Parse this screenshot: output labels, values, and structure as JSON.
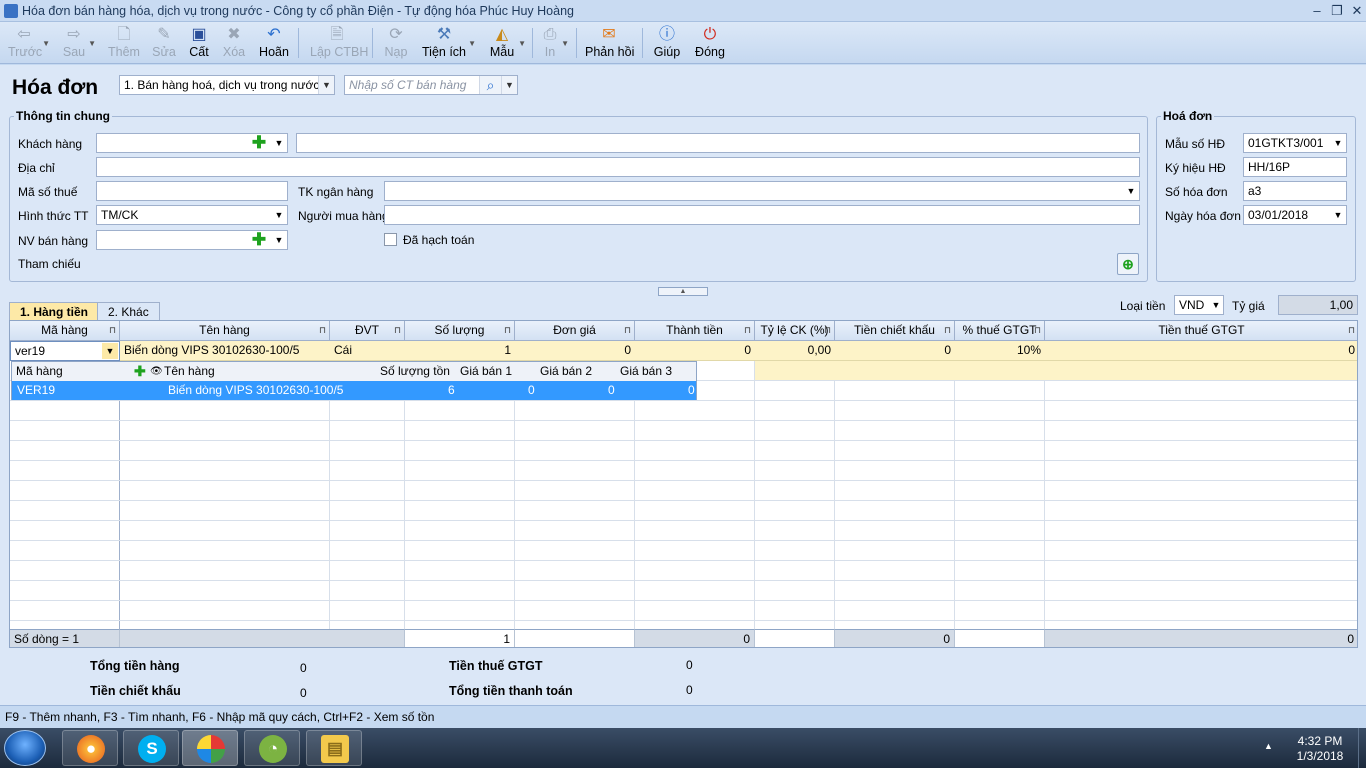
{
  "window": {
    "title": "Hóa đơn bán hàng hóa, dịch vụ trong nước - Công ty cổ phần Điện - Tự động hóa Phúc Huy Hoàng"
  },
  "toolbar": {
    "back": "Trước",
    "next": "Sau",
    "add": "Thêm",
    "edit": "Sửa",
    "save": "Cất",
    "delete": "Xóa",
    "undo": "Hoãn",
    "create_ctbh": "Lập CTBH",
    "load": "Nạp",
    "utilities": "Tiện ích",
    "template": "Mẫu",
    "print": "In",
    "feedback": "Phản hồi",
    "help": "Giúp",
    "close": "Đóng"
  },
  "header": {
    "title": "Hóa đơn",
    "invoice_type": "1. Bán hàng hoá, dịch vụ trong nước",
    "search_placeholder": "Nhập số CT bán hàng"
  },
  "general": {
    "title": "Thông tin chung",
    "customer_label": "Khách hàng",
    "customer_code": "",
    "customer_name": "",
    "address_label": "Địa chỉ",
    "address": "",
    "tax_code_label": "Mã số thuế",
    "tax_code": "",
    "bank_account_label": "TK ngân hàng",
    "bank_account": "",
    "payment_method_label": "Hình thức TT",
    "payment_method": "TM/CK",
    "buyer_label": "Người mua hàng",
    "buyer": "",
    "salesperson_label": "NV bán hàng",
    "salesperson": "",
    "posted_label": "Đã hạch toán",
    "posted": false,
    "reference_label": "Tham chiếu"
  },
  "invoice": {
    "title": "Hoá đơn",
    "form_no_label": "Mẫu số HĐ",
    "form_no": "01GTKT3/001",
    "symbol_label": "Ký hiệu HĐ",
    "symbol": "HH/16P",
    "number_label": "Số hóa đơn",
    "number": "a3",
    "date_label": "Ngày hóa đơn",
    "date": "03/01/2018"
  },
  "tabs": [
    {
      "label": "1. Hàng tiền",
      "active": true
    },
    {
      "label": "2. Khác",
      "active": false
    }
  ],
  "currency": {
    "label": "Loại tiền",
    "value": "VND",
    "rate_label": "Tỷ giá",
    "rate": "1,00"
  },
  "grid": {
    "columns": [
      "Mã hàng",
      "Tên hàng",
      "ĐVT",
      "Số lượng",
      "Đơn giá",
      "Thành tiền",
      "Tỷ lệ CK (%)",
      "Tiền chiết khấu",
      "% thuế GTGT",
      "Tiền thuế GTGT"
    ],
    "row": {
      "code": "ver19",
      "name": "Biến dòng VIPS 30102630-100/5",
      "unit": "Cái",
      "qty": "1",
      "price": "0",
      "amount": "0",
      "discount_rate": "0,00",
      "discount": "0",
      "vat_rate": "10%",
      "vat": "0"
    },
    "popup": {
      "headers": {
        "code": "Mã hàng",
        "name": "Tên hàng",
        "stock": "Số lượng tồn",
        "price1": "Giá bán 1",
        "price2": "Giá bán 2",
        "price3": "Giá bán 3"
      },
      "row": {
        "code": "VER19",
        "name": "Biến dòng VIPS 30102630-100/5",
        "stock": "6",
        "price1": "0",
        "price2": "0",
        "price3": "0"
      }
    },
    "footer": {
      "row_count": "Số dòng = 1",
      "qty": "1",
      "amount": "0",
      "discount": "0",
      "vat": "0"
    }
  },
  "totals": {
    "goods_label": "Tổng tiền hàng",
    "goods": "0",
    "discount_label": "Tiền chiết khấu",
    "discount": "0",
    "vat_label": "Tiền thuế GTGT",
    "vat": "0",
    "payment_label": "Tổng tiền thanh toán",
    "payment": "0"
  },
  "status_bar": "F9 - Thêm nhanh, F3 - Tìm nhanh, F6 - Nhập mã quy cách, Ctrl+F2 - Xem số tồn",
  "taskbar": {
    "time": "4:32 PM",
    "date": "1/3/2018"
  }
}
